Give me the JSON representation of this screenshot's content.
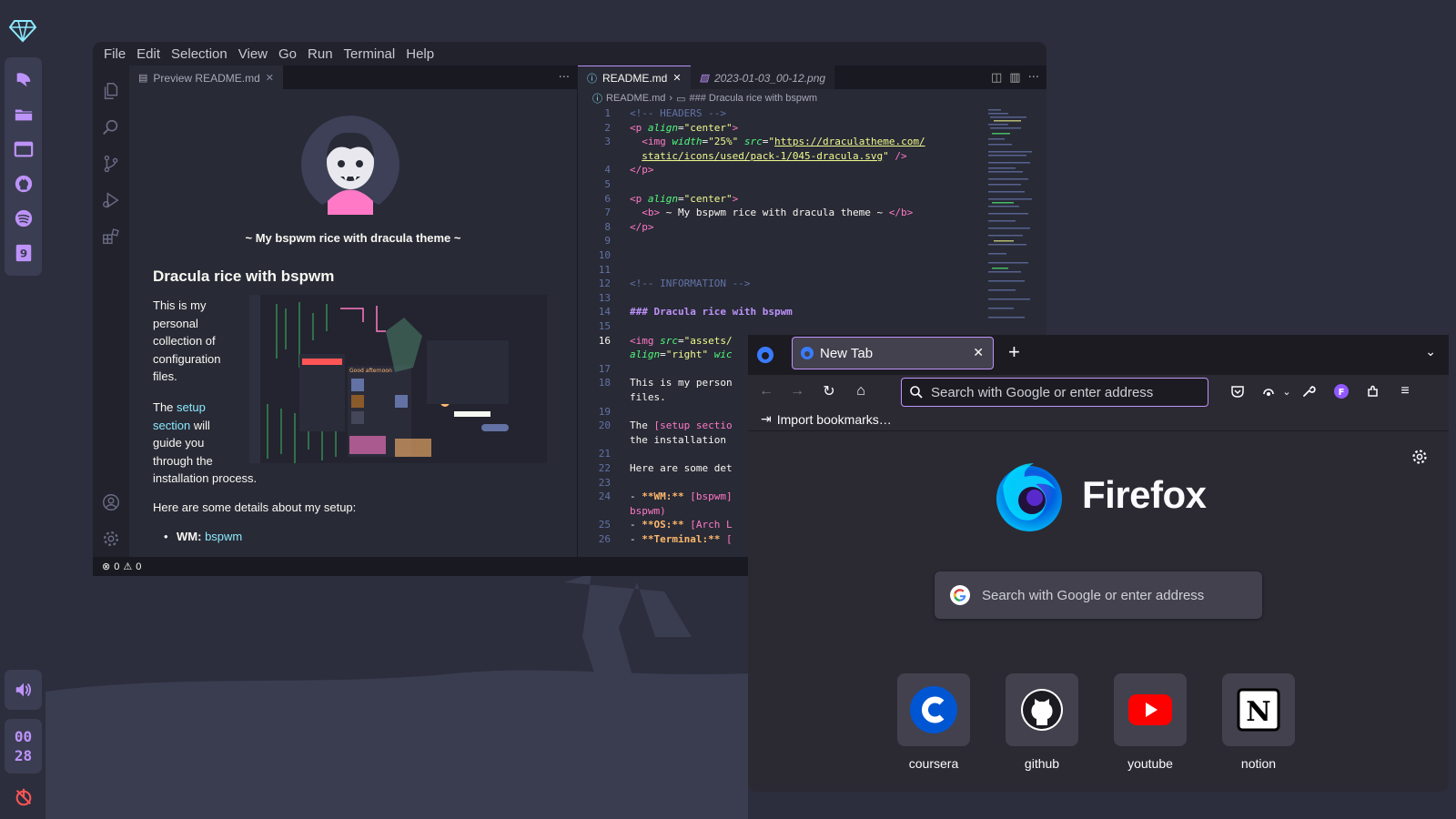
{
  "colors": {
    "background": "#2c2e3d",
    "dock": "#3b3d52",
    "accent": "#bd93f9",
    "editor_bg": "#282a36",
    "firefox_bg": "#2b2a33"
  },
  "dock": {
    "items": [
      "ghost-icon",
      "folder-icon",
      "window-icon",
      "github-icon",
      "spotify-icon",
      "notes-icon"
    ],
    "clock": {
      "hours": "00",
      "minutes": "28"
    }
  },
  "vscode": {
    "menu": [
      "File",
      "Edit",
      "Selection",
      "View",
      "Go",
      "Run",
      "Terminal",
      "Help"
    ],
    "preview_tab": "Preview README.md",
    "editor_tabs": [
      {
        "label": "README.md",
        "active": true
      },
      {
        "label": "2023-01-03_00-12.png",
        "active": false
      }
    ],
    "breadcrumbs": [
      "README.md",
      "### Dracula rice with bspwm"
    ],
    "preview": {
      "subtitle": "~ My bspwm rice with dracula theme ~",
      "heading": "Dracula rice with bspwm",
      "para1": [
        "This is my",
        "personal",
        "collection of",
        "configuration",
        "files."
      ],
      "para2_prefix": "The",
      "para2_link": "setup section",
      "para2_lines": [
        "will",
        "guide you",
        "through the",
        "installation process."
      ],
      "details": "Here are some details about my setup:",
      "wm_label": "WM:",
      "wm_value": "bspwm",
      "screenshot_caption": "Good afternoon"
    },
    "code_lines": [
      {
        "n": "1",
        "html": "<span class=\"c-cmt\">&lt;!-- HEADERS --&gt;</span>"
      },
      {
        "n": "2",
        "html": "<span class=\"c-tag\">&lt;p</span> <span class=\"c-attr\">align</span>=<span class=\"c-str\">\"center\"</span><span class=\"c-tag\">&gt;</span>"
      },
      {
        "n": "3",
        "html": "  <span class=\"c-tag\">&lt;img</span> <span class=\"c-attr\">width</span>=<span class=\"c-str\">\"25%\"</span> <span class=\"c-attr\">src</span>=<span class=\"c-str\">\"</span><span class=\"c-str-u\">https://draculatheme.com/</span>"
      },
      {
        "n": "",
        "html": "  <span class=\"c-str-u\">static/icons/used/pack-1/045-dracula.svg</span><span class=\"c-str\">\"</span> <span class=\"c-tag\">/&gt;</span>"
      },
      {
        "n": "4",
        "html": "<span class=\"c-tag\">&lt;/p&gt;</span>"
      },
      {
        "n": "5",
        "html": ""
      },
      {
        "n": "6",
        "html": "<span class=\"c-tag\">&lt;p</span> <span class=\"c-attr\">align</span>=<span class=\"c-str\">\"center\"</span><span class=\"c-tag\">&gt;</span>"
      },
      {
        "n": "7",
        "html": "  <span class=\"c-tag\">&lt;b&gt;</span> ~ My bspwm rice with dracula theme ~ <span class=\"c-tag\">&lt;/b&gt;</span>"
      },
      {
        "n": "8",
        "html": "<span class=\"c-tag\">&lt;/p&gt;</span>"
      },
      {
        "n": "9",
        "html": ""
      },
      {
        "n": "10",
        "html": ""
      },
      {
        "n": "11",
        "html": ""
      },
      {
        "n": "12",
        "html": "<span class=\"c-cmt\">&lt;!-- INFORMATION --&gt;</span>"
      },
      {
        "n": "13",
        "html": ""
      },
      {
        "n": "14",
        "html": "<span class=\"c-head\">### Dracula rice with bspwm</span>"
      },
      {
        "n": "15",
        "html": ""
      },
      {
        "n": "16",
        "html": "<span class=\"c-tag\">&lt;img</span> <span class=\"c-attr\">src</span>=<span class=\"c-str\">\"assets/</span>"
      },
      {
        "n": "",
        "html": "<span class=\"c-attr\">align</span>=<span class=\"c-str\">\"right\"</span> <span class=\"c-attr\">wic</span>"
      },
      {
        "n": "17",
        "html": ""
      },
      {
        "n": "18",
        "html": "This is my person"
      },
      {
        "n": "",
        "html": "files."
      },
      {
        "n": "19",
        "html": ""
      },
      {
        "n": "20",
        "html": "The <span class=\"c-link\">[setup sectio</span>"
      },
      {
        "n": "",
        "html": "the installation"
      },
      {
        "n": "21",
        "html": ""
      },
      {
        "n": "22",
        "html": "Here are some det"
      },
      {
        "n": "23",
        "html": ""
      },
      {
        "n": "24",
        "html": "- <span class=\"c-bold\">**WM:**</span> <span class=\"c-link\">[bspwm]</span>"
      },
      {
        "n": "",
        "html": "<span class=\"c-link\">bspwm)</span>"
      },
      {
        "n": "25",
        "html": "- <span class=\"c-bold\">**OS:**</span> <span class=\"c-link\">[Arch L</span>"
      },
      {
        "n": "26",
        "html": "- <span class=\"c-bold\">**Terminal:**</span> <span class=\"c-link\">[</span>"
      }
    ],
    "status": {
      "errors": "0",
      "warnings": "0"
    }
  },
  "firefox": {
    "tab_title": "New Tab",
    "urlbar_placeholder": "Search with Google or enter address",
    "import_bookmarks": "Import bookmarks…",
    "wordmark": "Firefox",
    "search_placeholder": "Search with Google or enter address",
    "shortcuts": [
      {
        "label": "coursera",
        "icon": "coursera-icon"
      },
      {
        "label": "github",
        "icon": "github-icon"
      },
      {
        "label": "youtube",
        "icon": "youtube-icon"
      },
      {
        "label": "notion",
        "icon": "notion-icon"
      }
    ]
  }
}
